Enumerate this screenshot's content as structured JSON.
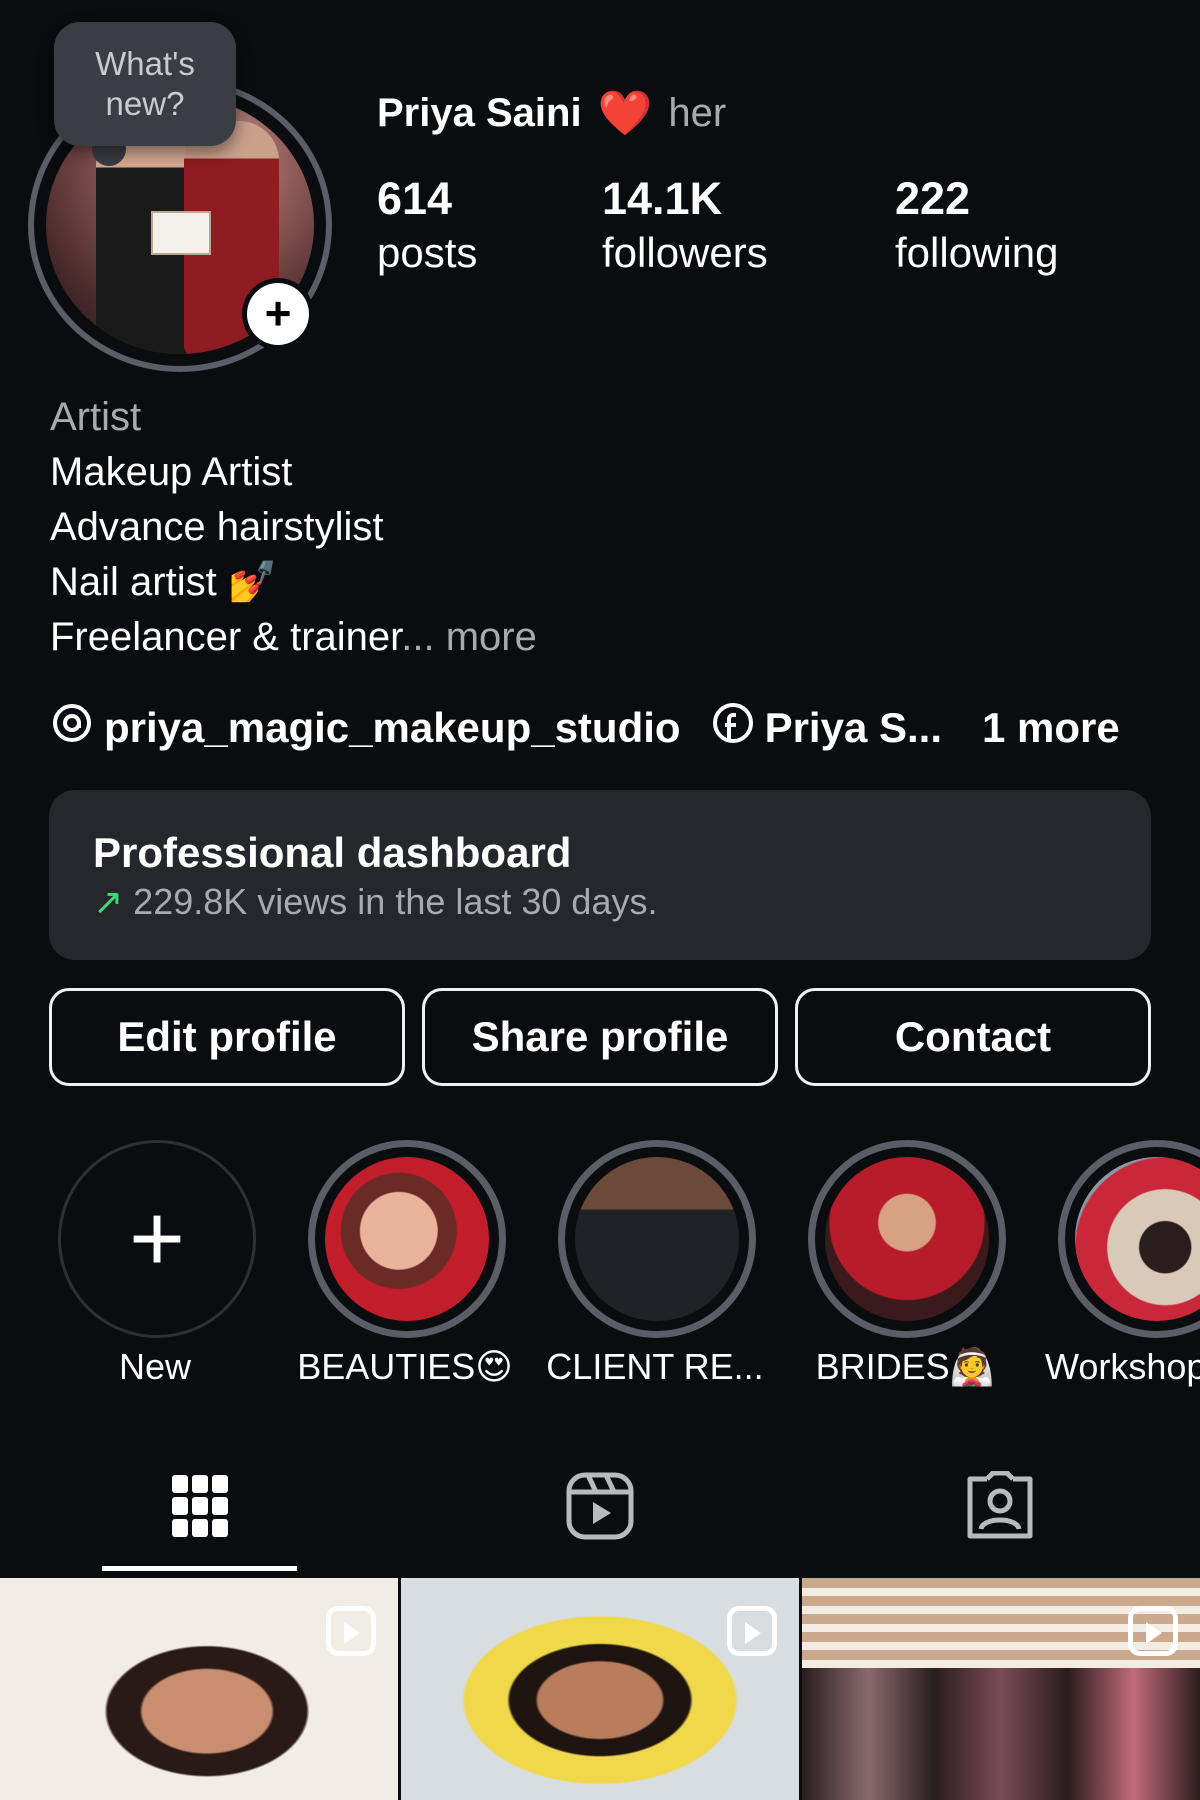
{
  "tooltip": {
    "text_line1": "What's",
    "text_line2": "new?"
  },
  "profile": {
    "name": "Priya Saini",
    "heart": "❤️",
    "pronouns": "her"
  },
  "stats": [
    {
      "value": "614",
      "label": "posts"
    },
    {
      "value": "14.1K",
      "label": "followers"
    },
    {
      "value": "222",
      "label": "following"
    }
  ],
  "bio": {
    "category": "Artist",
    "lines": [
      "Makeup Artist",
      "Advance hairstylist",
      "Nail artist 💅",
      "Freelancer & trainer"
    ],
    "ellipsis": "...",
    "more": " more"
  },
  "links": {
    "threads_handle": "priya_magic_makeup_studio",
    "facebook_name": "Priya S...",
    "more": "1 more",
    "threads_icon": "threads-icon",
    "facebook_icon": "facebook-icon"
  },
  "dashboard": {
    "title": "Professional dashboard",
    "arrow": "↗",
    "subtitle": "229.8K views in the last 30 days."
  },
  "buttons": {
    "edit": "Edit profile",
    "share": "Share profile",
    "contact": "Contact"
  },
  "highlights": [
    {
      "label": "New",
      "icon": "plus-icon"
    },
    {
      "label": "BEAUTIES😍"
    },
    {
      "label": "CLIENT RE..."
    },
    {
      "label": "BRIDES👰"
    },
    {
      "label": "Workshop"
    }
  ],
  "tabs": {
    "grid_icon": "grid-icon",
    "reels_icon": "reels-icon",
    "tagged_icon": "tagged-icon"
  },
  "colors": {
    "background": "#0b0c0f",
    "card": "#25272c",
    "accent_green": "#3ddc71",
    "heart_red": "#ff2d2d"
  }
}
